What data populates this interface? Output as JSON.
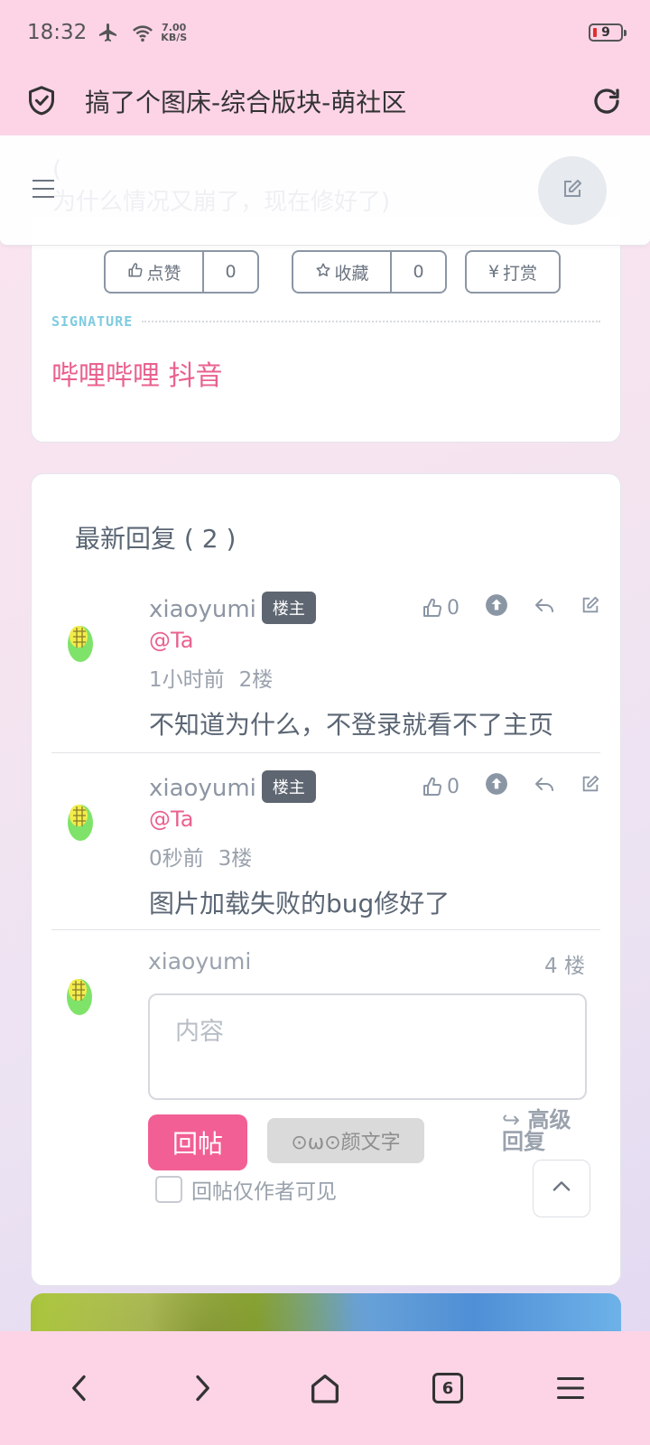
{
  "status_bar": {
    "time": "18:32",
    "speed_value": "7.00",
    "speed_unit": "KB/S",
    "battery_level": "9"
  },
  "browser": {
    "page_title": "搞了个图床-综合版块-萌社区",
    "tab_count": "6"
  },
  "header": {
    "ghost_text_line1": "(",
    "ghost_text_line2": "为什么情况又崩了，现在修好了)"
  },
  "post_actions": {
    "like_label": "点赞",
    "like_count": "0",
    "favorite_label": "收藏",
    "favorite_count": "0",
    "tip_label": "打赏"
  },
  "signature": {
    "label": "SIGNATURE",
    "text": "哔哩哔哩 抖音"
  },
  "replies_section": {
    "title": "最新回复",
    "count_text": "( 2 )",
    "replies": [
      {
        "author": "xiaoyumi",
        "badge": "楼主",
        "mention": "@Ta",
        "time": "1小时前",
        "floor": "2楼",
        "likes": "0",
        "content": "不知道为什么，不登录就看不了主页"
      },
      {
        "author": "xiaoyumi",
        "badge": "楼主",
        "mention": "@Ta",
        "time": "0秒前",
        "floor": "3楼",
        "likes": "0",
        "content": "图片加载失败的bug修好了"
      }
    ]
  },
  "compose": {
    "author": "xiaoyumi",
    "floor": "4 楼",
    "placeholder": "内容",
    "post_button": "回帖",
    "emoji_button": "⊙ω⊙颜文字",
    "advanced_line1": "高级",
    "advanced_line2": "回复",
    "author_only_label": "回帖仅作者可见"
  },
  "colors": {
    "accent_pink": "#f25f94",
    "mention_pink": "#e9618f",
    "signature_blue": "#7ecbe0",
    "bar_pink": "#fcd4e6"
  }
}
